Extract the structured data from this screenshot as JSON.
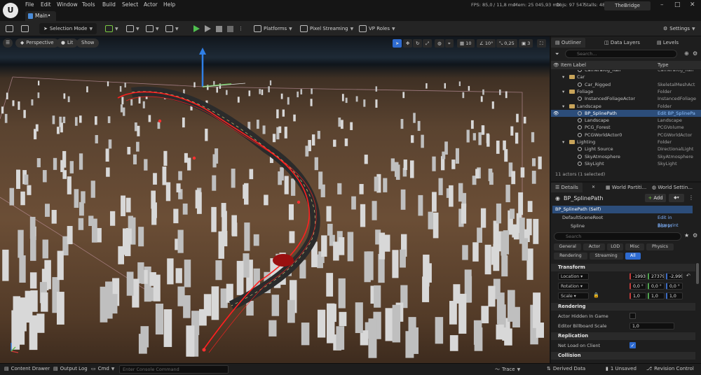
{
  "menubar": {
    "logo": "U",
    "items": [
      "File",
      "Edit",
      "Window",
      "Tools",
      "Build",
      "Select",
      "Actor",
      "Help"
    ],
    "tab": "Main•",
    "stats": {
      "fps": "FPS: 85,0",
      "ms": "/ 11,8 ms",
      "mem": "Mem: 25 045,93 mb",
      "objs": "Objs: 97 547",
      "stalls": "Stalls: 48"
    },
    "project": "TheBridge"
  },
  "toolbar": {
    "mode": "Selection Mode",
    "platforms": "Platforms",
    "pixel_streaming": "Pixel Streaming",
    "vp_roles": "VP Roles",
    "settings": "Settings"
  },
  "viewport": {
    "perspective": "Perspective",
    "lit": "Lit",
    "show": "Show",
    "grid_snap": "10",
    "rot_snap": "10°",
    "scale_snap": "0,25",
    "cam_speed": "3"
  },
  "outliner": {
    "tabs": [
      "Outliner",
      "Data Layers",
      "Levels"
    ],
    "search_placeholder": "Search...",
    "col_label": "Item Label",
    "col_type": "Type",
    "rows": [
      {
        "name": "CameraRig_Rail",
        "type": "CameraRig_Rail",
        "kind": "actor",
        "indent": 38,
        "selected": false
      },
      {
        "name": "Car",
        "type": "",
        "kind": "folder",
        "indent": 26,
        "selected": false
      },
      {
        "name": "Car_Rigged",
        "type": "SkeletalMeshAct",
        "kind": "actor",
        "indent": 38,
        "selected": false
      },
      {
        "name": "Foliage",
        "type": "Folder",
        "kind": "folder",
        "indent": 26,
        "selected": false
      },
      {
        "name": "InstancedFoliageActor",
        "type": "InstancedFoliage",
        "kind": "actor",
        "indent": 38,
        "selected": false
      },
      {
        "name": "Landscape",
        "type": "Folder",
        "kind": "folder",
        "indent": 26,
        "selected": false
      },
      {
        "name": "BP_SplinePath",
        "type": "Edit BP_SplinePa",
        "kind": "actor",
        "indent": 38,
        "selected": true
      },
      {
        "name": "Landscape",
        "type": "Landscape",
        "kind": "actor",
        "indent": 38,
        "selected": false
      },
      {
        "name": "PCG_Forest",
        "type": "PCGVolume",
        "kind": "actor",
        "indent": 38,
        "selected": false
      },
      {
        "name": "PCGWorldActor0",
        "type": "PCGWorldActor",
        "kind": "actor",
        "indent": 38,
        "selected": false
      },
      {
        "name": "Lighting",
        "type": "Folder",
        "kind": "folder",
        "indent": 26,
        "selected": false
      },
      {
        "name": "Light Source",
        "type": "DirectionalLight",
        "kind": "actor",
        "indent": 38,
        "selected": false
      },
      {
        "name": "SkyAtmosphere",
        "type": "SkyAtmosphere",
        "kind": "actor",
        "indent": 38,
        "selected": false
      },
      {
        "name": "SkyLight",
        "type": "SkyLight",
        "kind": "actor",
        "indent": 38,
        "selected": false
      }
    ],
    "status": "11 actors (1 selected)"
  },
  "details": {
    "tabs": [
      "Details",
      "World Partiti...",
      "World Settin..."
    ],
    "object": "BP_SplinePath",
    "add": "Add",
    "components": [
      {
        "name": "BP_SplinePath (Self)",
        "link": "",
        "selected": true,
        "indent": 4
      },
      {
        "name": "DefaultSceneRoot",
        "link": "Edit in Blueprint",
        "selected": false,
        "indent": 14
      },
      {
        "name": "Spline",
        "link": "Edit in Blueprint",
        "selected": false,
        "indent": 26
      }
    ],
    "search_placeholder": "Search",
    "filters_row1": [
      "General",
      "Actor",
      "LOD",
      "Misc",
      "Physics"
    ],
    "filters_row2": [
      "Rendering",
      "Streaming",
      "All"
    ],
    "transform": {
      "title": "Transform",
      "location_label": "Location",
      "rotation_label": "Rotation",
      "scale_label": "Scale",
      "location": [
        "-1993(",
        "27379,",
        "-2,999("
      ],
      "rotation": [
        "0,0 °",
        "0,0 °",
        "0,0 °"
      ],
      "scale": [
        "1,0",
        "1,0",
        "1,0"
      ]
    },
    "rendering": {
      "title": "Rendering",
      "hidden_label": "Actor Hidden In Game",
      "billboard_label": "Editor Billboard Scale",
      "billboard_value": "1,0"
    },
    "replication": {
      "title": "Replication",
      "net_load_label": "Net Load on Client"
    },
    "collision": {
      "title": "Collision"
    }
  },
  "bottombar": {
    "content_drawer": "Content Drawer",
    "output_log": "Output Log",
    "cmd": "Cmd",
    "console_placeholder": "Enter Console Command",
    "trace": "Trace",
    "derived_data": "Derived Data",
    "unsaved": "1 Unsaved",
    "revision": "Revision Control"
  }
}
